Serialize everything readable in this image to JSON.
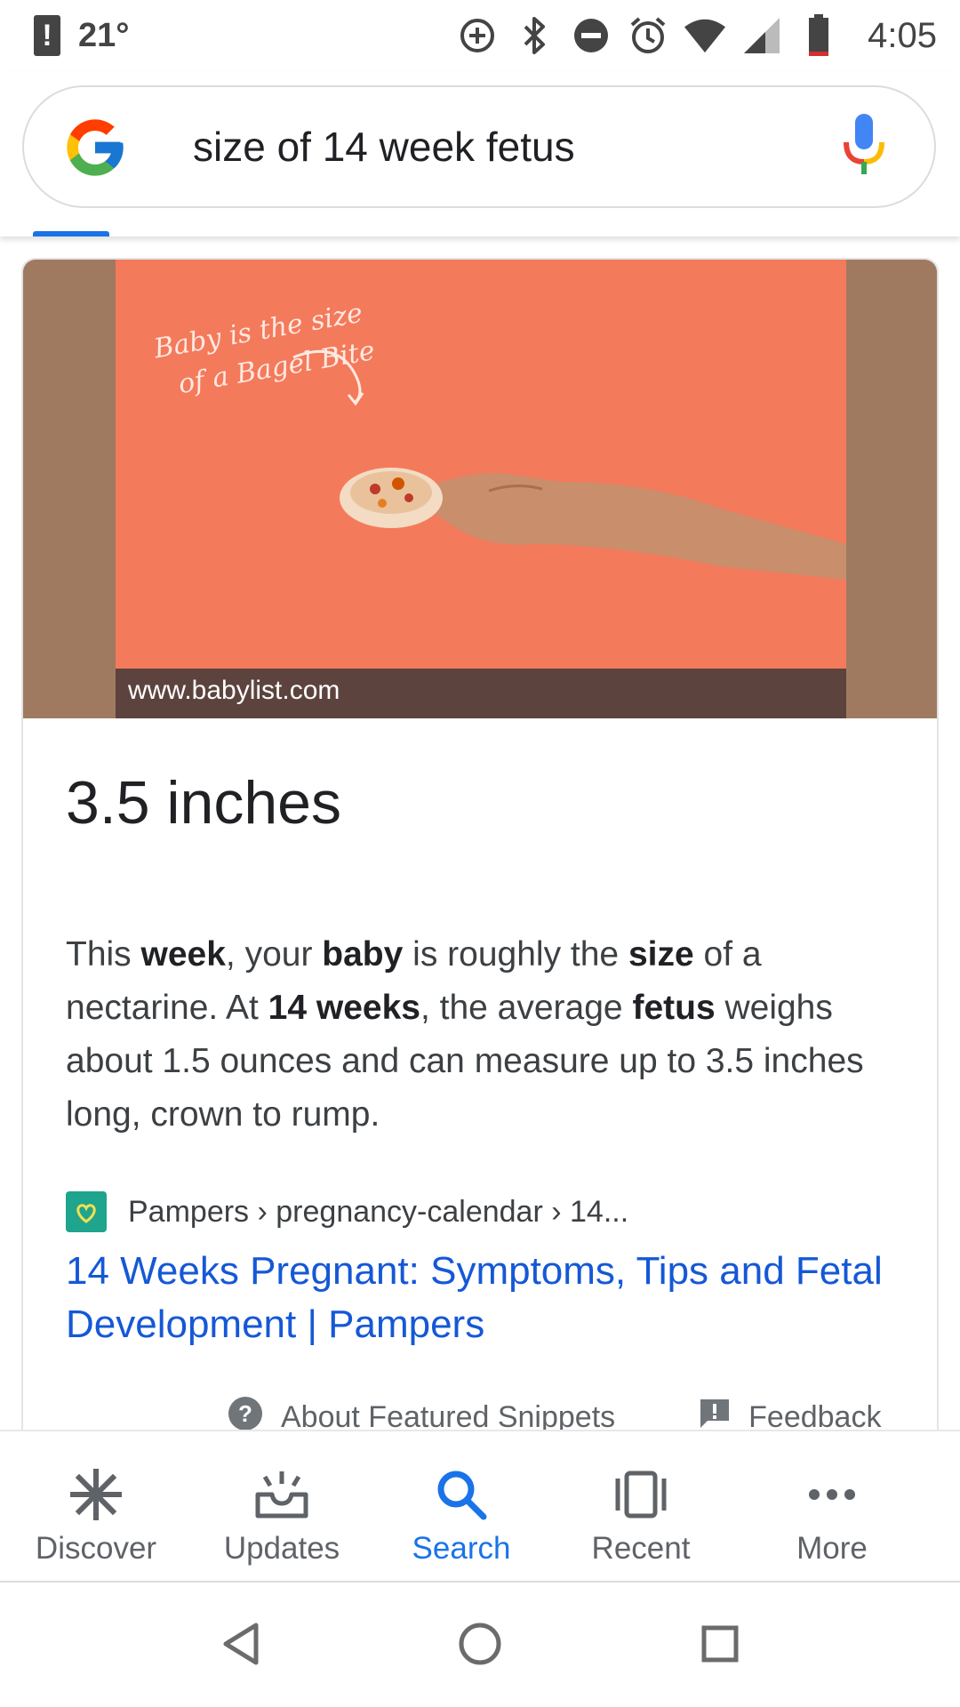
{
  "status_bar": {
    "temperature": "21°",
    "time": "4:05",
    "icons": [
      "alert-icon",
      "data-saver-icon",
      "bluetooth-icon",
      "do-not-disturb-icon",
      "alarm-icon",
      "wifi-icon",
      "signal-icon",
      "battery-icon"
    ]
  },
  "search": {
    "query": "size of 14 week fetus",
    "logo": "google-g-logo",
    "voice_icon": "mic-icon"
  },
  "featured_snippet": {
    "image_caption": "www.babylist.com",
    "image_script_text": [
      "Baby is the size",
      "of a Bagel Bite"
    ],
    "answer": "3.5 inches",
    "text_parts": [
      {
        "t": "This ",
        "b": false
      },
      {
        "t": "week",
        "b": true
      },
      {
        "t": ", your ",
        "b": false
      },
      {
        "t": "baby",
        "b": true
      },
      {
        "t": " is roughly the ",
        "b": false
      },
      {
        "t": "size",
        "b": true
      },
      {
        "t": " of a nectarine. At ",
        "b": false
      },
      {
        "t": "14 weeks",
        "b": true
      },
      {
        "t": ", the average ",
        "b": false
      },
      {
        "t": "fetus",
        "b": true
      },
      {
        "t": " weighs about 1.5 ounces and can measure up to 3.5 inches long, crown to rump.",
        "b": false
      }
    ],
    "source": "Pampers › pregnancy-calendar › 14...",
    "result_title": "14 Weeks Pregnant: Symptoms, Tips and Fetal Development | Pampers",
    "about_label": "About Featured Snippets",
    "feedback_label": "Feedback"
  },
  "bottom_nav": [
    {
      "label": "Discover",
      "icon": "asterisk-icon",
      "active": false
    },
    {
      "label": "Updates",
      "icon": "updates-tray-icon",
      "active": false
    },
    {
      "label": "Search",
      "icon": "search-icon",
      "active": true
    },
    {
      "label": "Recent",
      "icon": "recent-cards-icon",
      "active": false
    },
    {
      "label": "More",
      "icon": "more-dots-icon",
      "active": false
    }
  ],
  "colors": {
    "accent": "#1a73e8",
    "link": "#1558d6",
    "hero_bg": "#f47a5c",
    "hero_side": "#a07a60",
    "caption_bg": "#5d433e"
  }
}
